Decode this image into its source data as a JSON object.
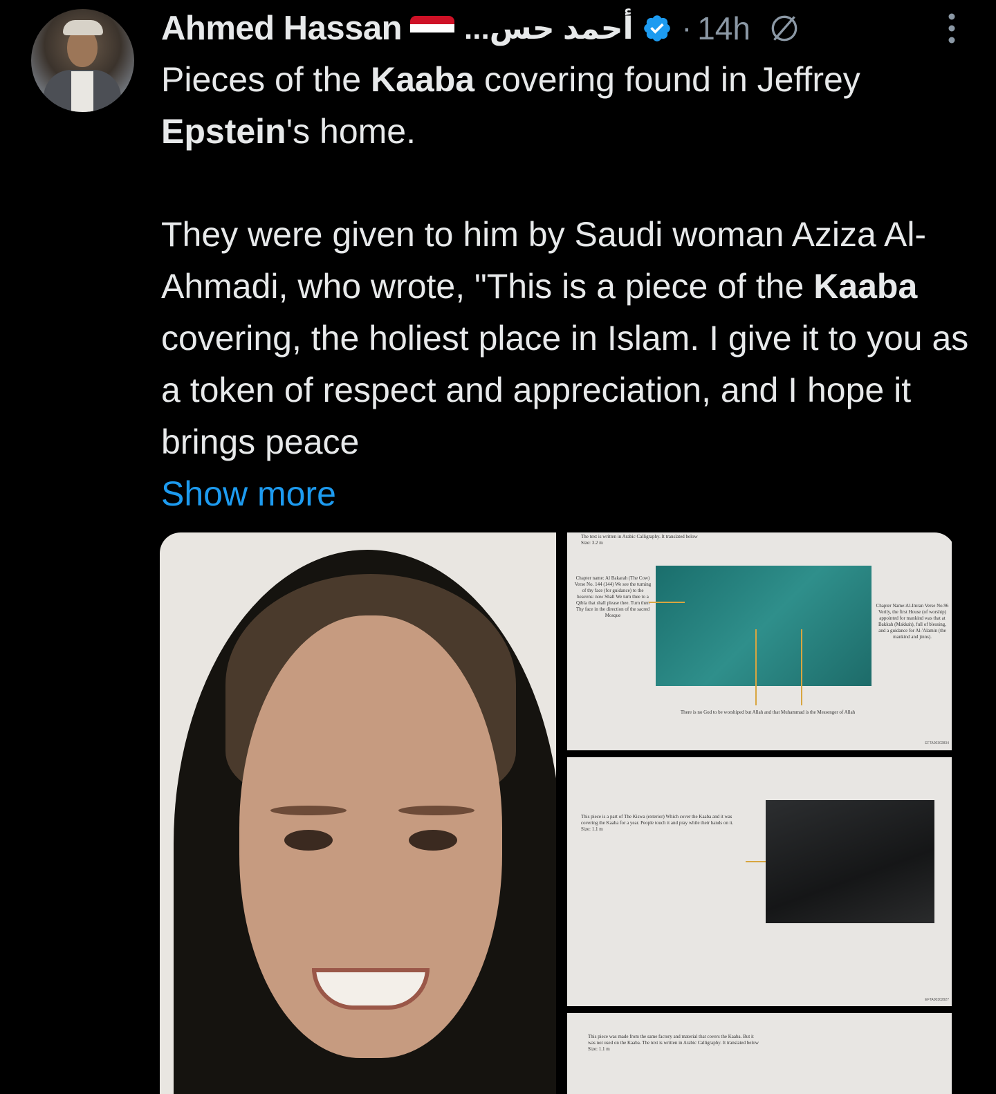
{
  "author": {
    "name": "Ahmed Hassan",
    "flag": "yemen-flag",
    "handle": "أحمد حس...",
    "verified": true,
    "timestamp": "14h"
  },
  "tweet": {
    "para1": {
      "a": "Pieces of the ",
      "b": "Kaaba",
      "c": " covering found in Jeffrey ",
      "d": "Epstein",
      "e": "'s home."
    },
    "para2": {
      "a": "They were given to him by Saudi woman Aziza Al-Ahmadi, who wrote, \"This is a piece of the ",
      "b": "Kaaba",
      "c": " covering, the holiest place in Islam. I give it to you as a token of respect and appreciation, and I hope it brings peace"
    },
    "show_more": "Show more"
  },
  "document": {
    "p1_header": "The text is written in Arabic Calligraphy. It translated below\nSize: 3.2 m",
    "p1_left": "Chapter name: Al Bakarah (The Cow) Verse No. 144\n(144) We see the turning of thy face (for guidance) to the heavens: now Shall We turn thee to a Qibla that shall please thee. Turn then Thy face in the direction of the sacred Mosque",
    "p1_right": "Chapter Name:Al-Imran Verse No.96\nVerily, the first House (of worship) appointed for mankind was that at Bakkah (Makkah), full of blessing, and a guidance for Al-'Alamin (the mankind and jinns).",
    "p1_bottom": "There is no God to be worshiped but Allah and that Muhammad is the Messenger of Allah",
    "p2_text": "This piece is a part of The Kiswa (exterior) Which cover the Kaaba and it was covering the Kaaba for a year. People touch it and pray while their hands on it.\nSize: 1.1 m",
    "p3_text": "This piece was made from the same factory and material that covers the Kaaba. But it was not used on the Kaaba. The text is written in Arabic Calligraphy. It translated below\nSize: 1.1 m",
    "ref1": "EFTA00302834",
    "ref2": "EFTA00302927"
  },
  "colors": {
    "background": "#000000",
    "text": "#e7e9ea",
    "muted": "#8b98a5",
    "link": "#1d9bf0",
    "verified": "#1d9bf0"
  }
}
